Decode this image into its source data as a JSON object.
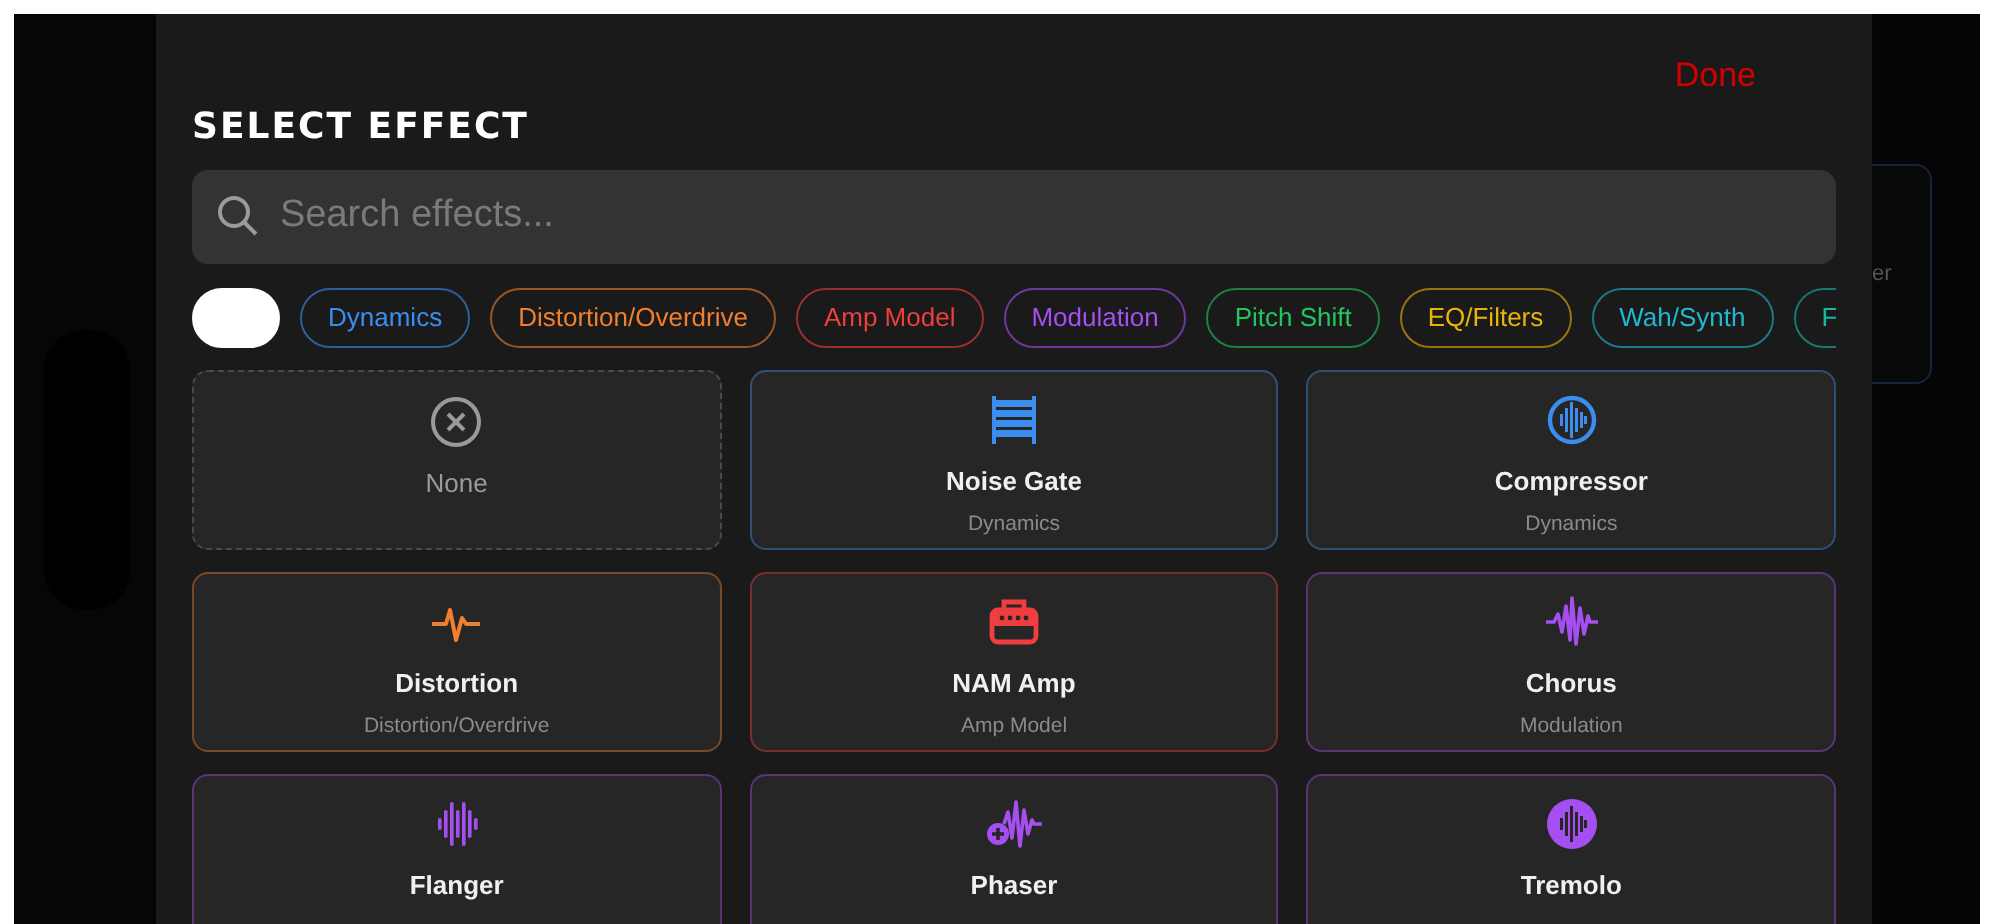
{
  "background_card": {
    "text": "er"
  },
  "done_button": "Done",
  "title": "SELECT EFFECT",
  "search": {
    "placeholder": "Search effects..."
  },
  "filters": [
    {
      "color": "#ffffff",
      "selected": true
    },
    {
      "label": "Dynamics",
      "color": "#3b8ef0",
      "selected": false
    },
    {
      "label": "Distortion/Overdrive",
      "color": "#f07f2e",
      "selected": false
    },
    {
      "label": "Amp Model",
      "color": "#ef3e3e",
      "selected": false
    },
    {
      "label": "Modulation",
      "color": "#a64ff0",
      "selected": false
    },
    {
      "label": "Pitch Shift",
      "color": "#22c55e",
      "selected": false
    },
    {
      "label": "EQ/Filters",
      "color": "#eab308",
      "selected": false
    },
    {
      "label": "Wah/Synth",
      "color": "#22b8cf",
      "selected": false
    },
    {
      "label": "F",
      "color": "#14b8a6",
      "selected": false
    }
  ],
  "effects": [
    {
      "kind": "none",
      "name": "None"
    },
    {
      "kind": "effect",
      "name": "Noise Gate",
      "category": "Dynamics",
      "color": "#3b8ef0"
    },
    {
      "kind": "effect",
      "name": "Compressor",
      "category": "Dynamics",
      "color": "#3b8ef0"
    },
    {
      "kind": "effect",
      "name": "Distortion",
      "category": "Distortion/Overdrive",
      "color": "#f07f2e"
    },
    {
      "kind": "effect",
      "name": "NAM Amp",
      "category": "Amp Model",
      "color": "#ef3e3e"
    },
    {
      "kind": "effect",
      "name": "Chorus",
      "category": "Modulation",
      "color": "#a64ff0"
    },
    {
      "kind": "effect",
      "name": "Flanger",
      "color": "#a64ff0"
    },
    {
      "kind": "effect",
      "name": "Phaser",
      "color": "#a64ff0"
    },
    {
      "kind": "effect",
      "name": "Tremolo",
      "color": "#a64ff0"
    }
  ]
}
